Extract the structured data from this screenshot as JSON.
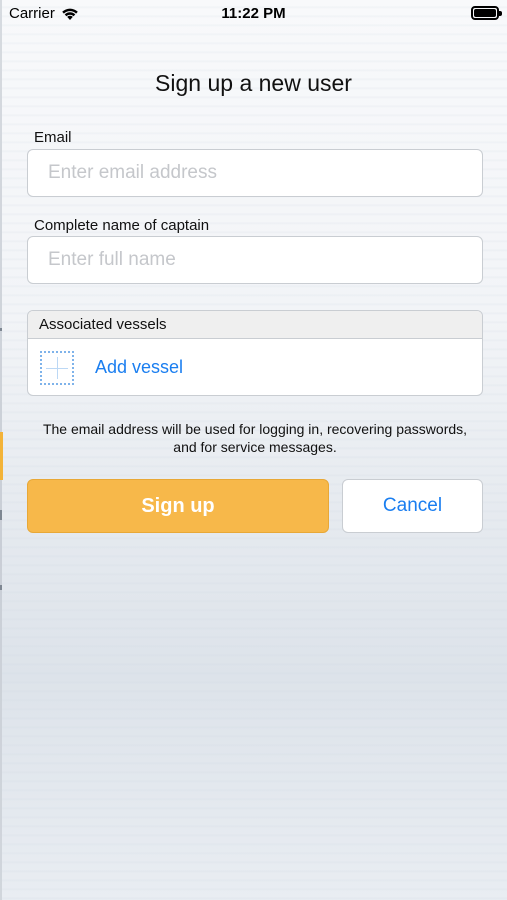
{
  "status_bar": {
    "carrier": "Carrier",
    "time": "11:22 PM",
    "wifi_icon": "wifi-icon",
    "battery_icon": "battery-icon"
  },
  "title": "Sign up a new user",
  "email": {
    "label": "Email",
    "placeholder": "Enter email address",
    "value": ""
  },
  "captain": {
    "label": "Complete name of captain",
    "placeholder": "Enter full name",
    "value": ""
  },
  "vessels": {
    "header": "Associated vessels",
    "add_label": "Add vessel",
    "add_icon": "add-icon"
  },
  "info_text": "The email address will be used for logging in, recovering passwords, and for service messages.",
  "buttons": {
    "signup": "Sign up",
    "cancel": "Cancel"
  },
  "colors": {
    "accent": "#f7b84a",
    "link": "#1a7ef0"
  }
}
